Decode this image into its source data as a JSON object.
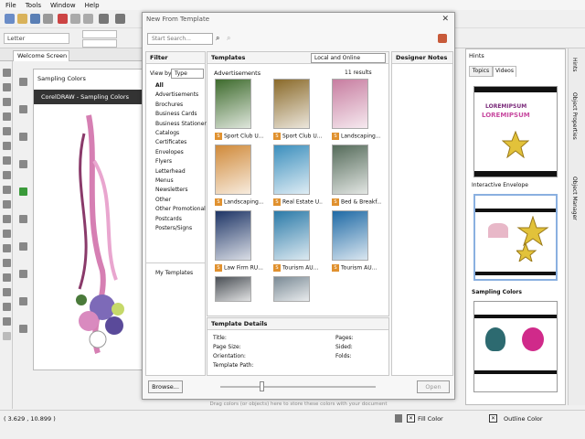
{
  "menu": [
    "File",
    "Tools",
    "Window",
    "Help"
  ],
  "toolbar": {
    "page_size": "Letter"
  },
  "doc_tab": "Welcome Screen",
  "canvas": {
    "sampling_label": "Sampling Colors",
    "banner": "CorelDRAW - Sampling Colors"
  },
  "dialog": {
    "title": "New From Template",
    "search_placeholder": "Start Search...",
    "filter": {
      "header": "Filter",
      "view_by_label": "View by:",
      "view_by_value": "Type",
      "items": [
        "All",
        "Advertisements",
        "Brochures",
        "Business Cards",
        "Business Stationery",
        "Catalogs",
        "Certificates",
        "Envelopes",
        "Flyers",
        "Letterhead",
        "Menus",
        "Newsletters",
        "Other",
        "Other Promotional",
        "Postcards",
        "Posters/Signs"
      ],
      "my_templates": "My Templates"
    },
    "templates": {
      "header": "Templates",
      "source": "Local and Online",
      "category": "Advertisements",
      "count": "11 results",
      "items": [
        {
          "label": "Sport Club U...",
          "color": "#3e6b2d"
        },
        {
          "label": "Sport Club U...",
          "color": "#8a6a2a"
        },
        {
          "label": "Landscaping...",
          "color": "#c77da0"
        },
        {
          "label": "Landscaping...",
          "color": "#d08a3a"
        },
        {
          "label": "Real Estate U...",
          "color": "#3c8fbd"
        },
        {
          "label": "Bed & Breakf...",
          "color": "#556b5a"
        },
        {
          "label": "Law Firm RU...",
          "color": "#1e3566"
        },
        {
          "label": "Tourism AU...",
          "color": "#2b7aa8"
        },
        {
          "label": "Tourism AU...",
          "color": "#1f6aa5"
        },
        {
          "label": "",
          "color": "#4a4f55"
        },
        {
          "label": "",
          "color": "#7a8a95"
        }
      ]
    },
    "designer_notes": {
      "header": "Designer Notes"
    },
    "details": {
      "header": "Template Details",
      "title": "Title:",
      "page_size": "Page Size:",
      "orientation": "Orientation:",
      "path": "Template Path:",
      "pages": "Pages:",
      "sided": "Sided:",
      "folds": "Folds:"
    },
    "browse_label": "Browse...",
    "open_label": "Open",
    "drag_hint": "Drag colors (or objects) here to store these colors with your document"
  },
  "hints": {
    "header": "Hints",
    "tabs": [
      "Topics",
      "Videos"
    ],
    "video1_logo_top": "LOREMIPSUM",
    "video1_logo_bottom": "LOREMIPSUM",
    "video2_caption": "Interactive Envelope",
    "video3_caption": "Sampling Colors"
  },
  "side_tabs": [
    "Hints",
    "Object Properties",
    "Object Manager"
  ],
  "status": {
    "coords": "( 3.629 , 10.899 )",
    "fill": "Fill Color",
    "outline": "Outline Color"
  },
  "colors": {
    "accent": "#3a78c8",
    "orange": "#e0912f",
    "dark": "#2f2f2f"
  }
}
